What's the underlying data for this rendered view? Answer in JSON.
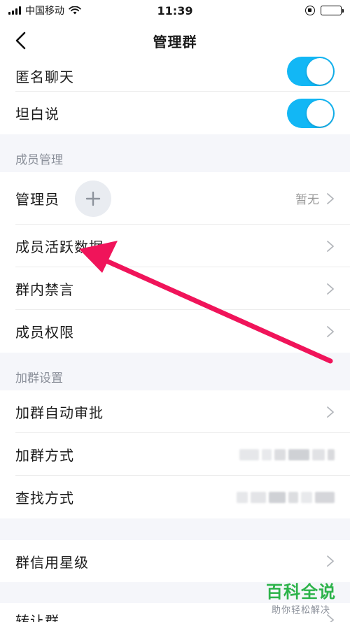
{
  "status_bar": {
    "carrier": "中国移动",
    "time": "11:39"
  },
  "nav": {
    "title": "管理群"
  },
  "rows": {
    "anonymous_chat": "匿名聊天",
    "tanbai": "坦白说",
    "admin": "管理员",
    "admin_value": "暂无",
    "member_activity": "成员活跃数据",
    "group_mute": "群内禁言",
    "member_permission": "成员权限",
    "join_auto_approve": "加群自动审批",
    "join_method": "加群方式",
    "search_method": "查找方式",
    "credit_star": "群信用星级",
    "transfer_group": "转让群"
  },
  "sections": {
    "member_management": "成员管理",
    "join_settings": "加群设置"
  },
  "toggles": {
    "anonymous_chat_on": true,
    "tanbai_on": true
  },
  "colors": {
    "toggle_on": "#12b7f5",
    "arrow": "#f0145a",
    "watermark": "#2db34a"
  },
  "watermark": {
    "title": "百科全说",
    "subtitle": "助你轻松解决"
  }
}
